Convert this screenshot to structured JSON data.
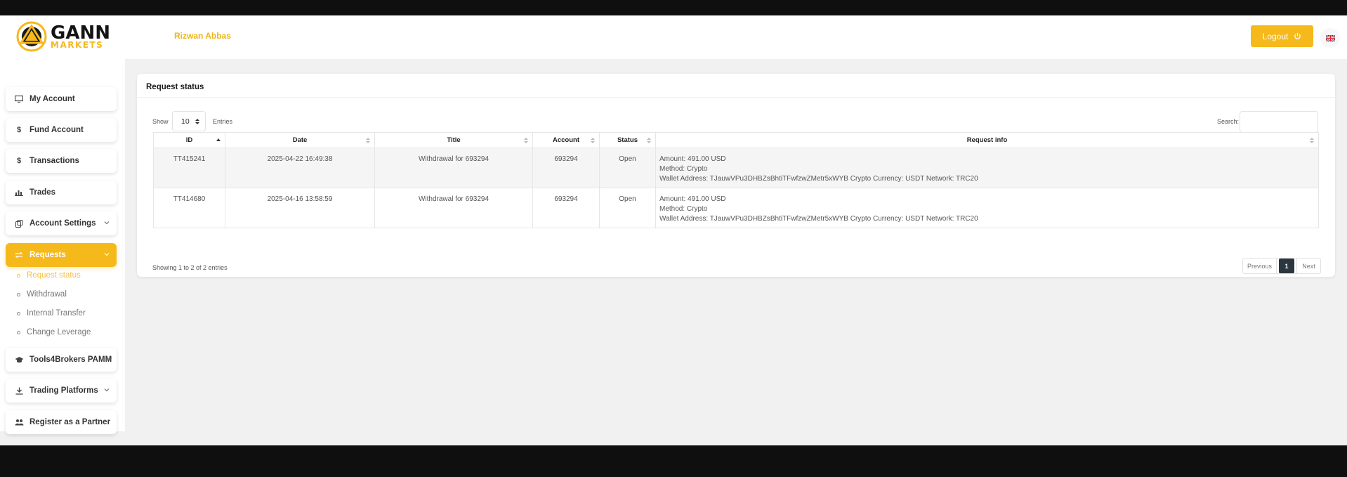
{
  "header": {
    "logo_main": "GANN",
    "logo_sub": "MARKETS",
    "username": "Rizwan Abbas",
    "logout_label": "Logout"
  },
  "sidebar": {
    "items": [
      {
        "label": "My Account",
        "icon": "monitor-icon"
      },
      {
        "label": "Fund Account",
        "icon": "dollar-icon"
      },
      {
        "label": "Transactions",
        "icon": "dollar-icon"
      },
      {
        "label": "Trades",
        "icon": "bar-chart-icon"
      },
      {
        "label": "Account Settings",
        "icon": "settings-icon"
      },
      {
        "label": "Requests",
        "icon": "swap-icon"
      },
      {
        "label": "Tools4Brokers PAMM",
        "icon": "graduation-cap-icon"
      },
      {
        "label": "Trading Platforms",
        "icon": "download-icon"
      },
      {
        "label": "Register as a Partner",
        "icon": "users-icon"
      }
    ],
    "requests_sub": [
      {
        "label": "Request status"
      },
      {
        "label": "Withdrawal"
      },
      {
        "label": "Internal Transfer"
      },
      {
        "label": "Change Leverage"
      }
    ]
  },
  "card": {
    "title": "Request status",
    "show_label": "Show",
    "page_size": "10",
    "entries_label": "Entries",
    "search_label": "Search:"
  },
  "table": {
    "columns": [
      "ID",
      "Date",
      "Title",
      "Account",
      "Status",
      "Request info"
    ],
    "rows": [
      {
        "id": "TT415241",
        "date": "2025-04-22 16:49:38",
        "title": "Withdrawal for 693294",
        "account": "693294",
        "status": "Open",
        "info_amount": "Amount: 491.00 USD",
        "info_method": "Method: Crypto",
        "info_wallet": "Wallet Address: TJauwVPu3DHBZsBhtiTFwfzwZMetr5xWYB Crypto Currency: USDT Network: TRC20"
      },
      {
        "id": "TT414680",
        "date": "2025-04-16 13:58:59",
        "title": "Withdrawal for 693294",
        "account": "693294",
        "status": "Open",
        "info_amount": "Amount: 491.00 USD",
        "info_method": "Method: Crypto",
        "info_wallet": "Wallet Address: TJauwVPu3DHBZsBhtiTFwfzwZMetr5xWYB Crypto Currency: USDT Network: TRC20"
      }
    ]
  },
  "footer": {
    "showing": "Showing 1 to 2 of 2 entries",
    "prev": "Previous",
    "page": "1",
    "next": "Next"
  },
  "colors": {
    "accent": "#f6b91c",
    "pager_active": "#2c3640"
  }
}
